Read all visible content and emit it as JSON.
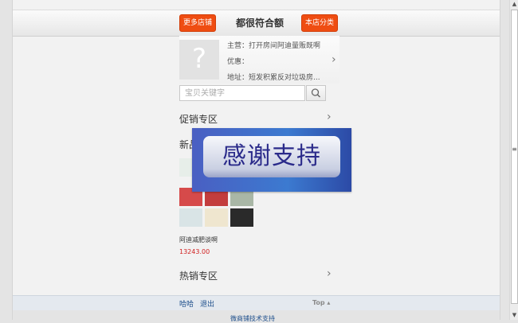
{
  "header": {
    "more_shops": "更多店铺",
    "title": "都很符合额",
    "categories": "本店分类"
  },
  "shop": {
    "main_label": "主营：打开房间阿迪量贩既啊",
    "promo_label": "优惠：",
    "address_label": "地址：短发积累反对垃圾房...",
    "avatar_icon": "placeholder-question-icon"
  },
  "search": {
    "placeholder": "宝贝关键字",
    "icon": "search-icon"
  },
  "sections": {
    "promo": "促销专区",
    "new": "新品",
    "hot": "热销专区"
  },
  "product": {
    "name": "阿迪减肥谈啊",
    "price": "13243.00"
  },
  "footer": {
    "link1": "哈哈",
    "link2": "退出",
    "top": "Top",
    "tech": "微商铺技术支持"
  },
  "overlay": {
    "text": "感谢支持"
  },
  "colors": {
    "accent": "#ef4d12",
    "link": "#1e4f8c",
    "price": "#d02020"
  }
}
